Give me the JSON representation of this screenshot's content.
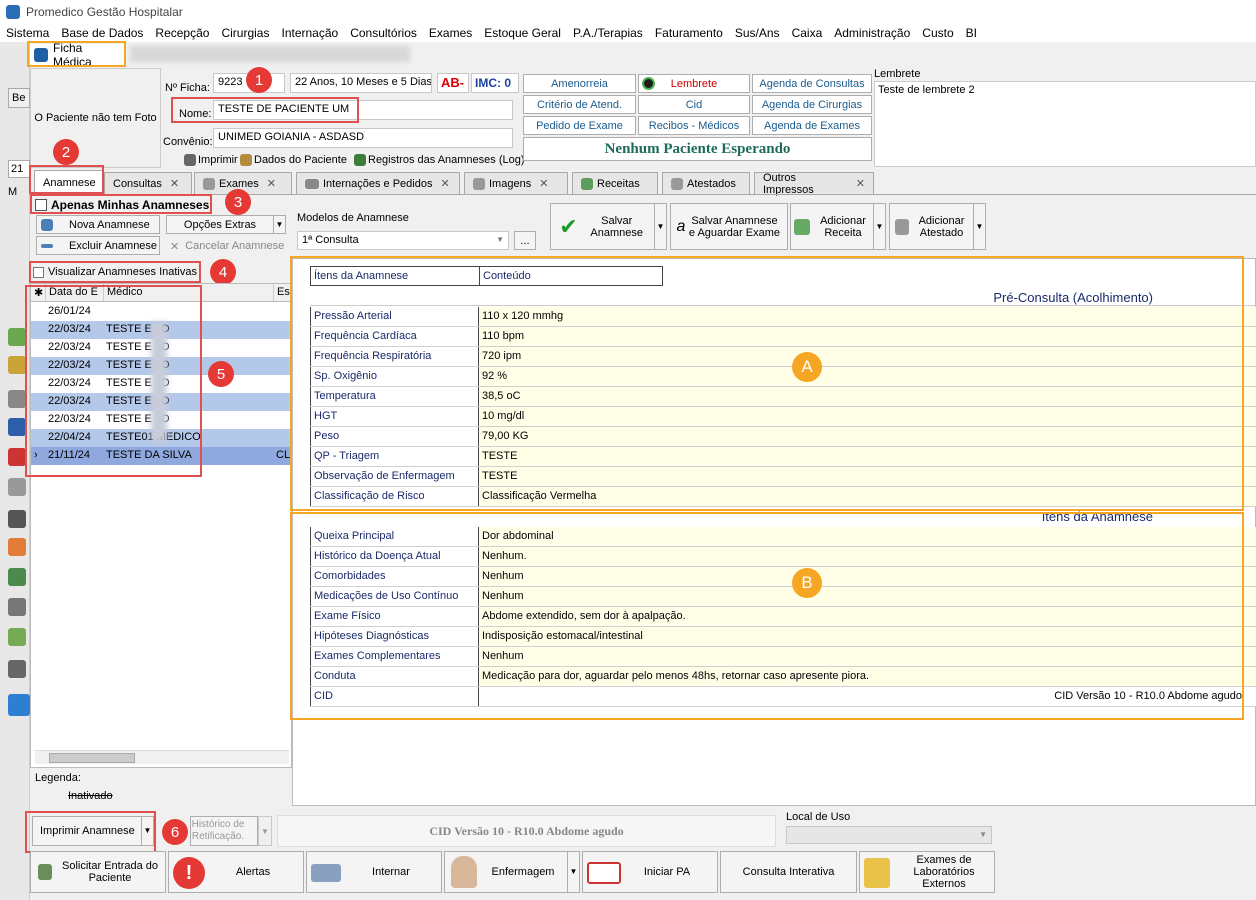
{
  "window": {
    "title": "Promedico Gestão Hospitalar"
  },
  "menu": [
    "Sistema",
    "Base de Dados",
    "Recepção",
    "Cirurgias",
    "Internação",
    "Consultórios",
    "Exames",
    "Estoque Geral",
    "P.A./Terapias",
    "Faturamento",
    "Sus/Ans",
    "Caixa",
    "Administração",
    "Custo",
    "BI"
  ],
  "ficha_tab": "Ficha Médica",
  "patient": {
    "photo_text": "O Paciente não tem Foto",
    "ficha_label": "Nº Ficha:",
    "ficha_value": "9223",
    "age": "22 Anos, 10 Meses e 5 Dias",
    "ab": "AB-",
    "imc": "IMC: 0",
    "nome_label": "Nome:",
    "nome_value": "TESTE DE PACIENTE UM",
    "convenio_label": "Convênio:",
    "convenio_value": "UNIMED GOIANIA - ASDASD",
    "imprimir": "Imprimir",
    "dados": "Dados do Paciente",
    "registros": "Registros das Anamneses (Log)"
  },
  "quick_buttons": [
    [
      "Amenorreia",
      "Lembrete",
      "Agenda de Consultas"
    ],
    [
      "Critério de Atend.",
      "Cid",
      "Agenda de Cirurgias"
    ],
    [
      "Pedido de Exame",
      "Recibos - Médicos",
      "Agenda de Exames"
    ]
  ],
  "waiting": "Nenhum Paciente Esperando",
  "lembrete": {
    "label": "Lembrete",
    "text": "Teste de lembrete 2"
  },
  "left_stub": {
    "tab": "Be",
    "value": "21",
    "check": "M"
  },
  "tabs": [
    "Anamnese",
    "Consultas",
    "Exames",
    "Internações e Pedidos",
    "Imagens",
    "Receitas",
    "Atestados",
    "Outros Impressos"
  ],
  "left_panel": {
    "only_mine": "Apenas Minhas Anamneses",
    "nova": "Nova Anamnese",
    "opcoes": "Opções Extras",
    "excluir": "Excluir Anamnese",
    "cancelar": "Cancelar Anamnese",
    "inativas": "Visualizar Anamneses Inativas",
    "col_date": "Data do E",
    "col_medico": "Médico",
    "col_es": "Es",
    "rows": [
      {
        "date": "26/01/24",
        "medico": "",
        "es": ""
      },
      {
        "date": "22/03/24",
        "medico": "TESTE E   O",
        "es": ""
      },
      {
        "date": "22/03/24",
        "medico": "TESTE E   O",
        "es": ""
      },
      {
        "date": "22/03/24",
        "medico": "TESTE E   O",
        "es": ""
      },
      {
        "date": "22/03/24",
        "medico": "TESTE E   O",
        "es": ""
      },
      {
        "date": "22/03/24",
        "medico": "TESTE E   O",
        "es": ""
      },
      {
        "date": "22/03/24",
        "medico": "TESTE E   O",
        "es": ""
      },
      {
        "date": "22/04/24",
        "medico": "TESTE01 MEDICO",
        "es": ""
      },
      {
        "date": "21/11/24",
        "medico": "TESTE DA SILVA",
        "es": "CL"
      }
    ],
    "legenda": "Legenda:",
    "inativado": "Inativado"
  },
  "modelos": {
    "label": "Modelos de Anamnese",
    "value": "1ª Consulta",
    "ellipsis": "..."
  },
  "toolbar": {
    "salvar": "Salvar Anamnese",
    "salvar_aguardar": "Salvar Anamnese e Aguardar Exame",
    "receita": "Adicionar Receita",
    "atestado": "Adicionar Atestado"
  },
  "table": {
    "col_item": "Ítens da Anamnese",
    "col_conteudo": "Conteúdo",
    "section_a": "Pré-Consulta (Acolhimento)",
    "rows_a": [
      {
        "item": "Pressão Arterial",
        "value": "110 x 120 mmhg"
      },
      {
        "item": "Frequência Cardíaca",
        "value": "110 bpm"
      },
      {
        "item": "Frequência Respiratória",
        "value": "720 ipm"
      },
      {
        "item": "Sp. Oxigênio",
        "value": "92 %"
      },
      {
        "item": "Temperatura",
        "value": "38,5 oC"
      },
      {
        "item": "HGT",
        "value": "10 mg/dl"
      },
      {
        "item": "Peso",
        "value": "79,00 KG"
      },
      {
        "item": "QP - Triagem",
        "value": "TESTE"
      },
      {
        "item": "Observação de Enfermagem",
        "value": "TESTE"
      },
      {
        "item": "Classificação de Risco",
        "value": "Classificação Vermelha"
      }
    ],
    "section_b": "Itens da Anamnese",
    "rows_b": [
      {
        "item": "Queixa Principal",
        "value": "Dor abdominal"
      },
      {
        "item": "Histórico da Doença Atual",
        "value": "Nenhum."
      },
      {
        "item": "Comorbidades",
        "value": "Nenhum"
      },
      {
        "item": "Medicações de Uso Contínuo",
        "value": "Nenhum"
      },
      {
        "item": "Exame Físico",
        "value": "Abdome extendido, sem dor à apalpação."
      },
      {
        "item": "Hipóteses Diagnósticas",
        "value": "Indisposição estomacal/intestinal"
      },
      {
        "item": "Exames Complementares",
        "value": "Nenhum"
      },
      {
        "item": "Conduta",
        "value": "Medicação para dor, aguardar pelo menos 48hs, retornar caso apresente piora."
      },
      {
        "item": "CID",
        "value": "CID Versão 10 - R10.0 Abdome agudo"
      }
    ]
  },
  "bottom": {
    "imprimir": "Imprimir Anamnese",
    "historico": "Histórico de Retificação.",
    "cid_status": "CID Versão 10 - R10.0 Abdome agudo",
    "local_label": "Local de Uso"
  },
  "footer": [
    "Solicitar Entrada do Paciente",
    "Alertas",
    "Internar",
    "Enfermagem",
    "Iniciar PA",
    "Consulta Interativa",
    "Exames de Laboratórios Externos"
  ],
  "annotations": {
    "n1": "1",
    "n2": "2",
    "n3": "3",
    "n4": "4",
    "n5": "5",
    "n6": "6",
    "a": "A",
    "b": "B"
  },
  "colors": {
    "highlight": "#f5a623",
    "badge": "#e53935",
    "field_bg": "#ffffe8",
    "link": "#1a5c8e"
  }
}
